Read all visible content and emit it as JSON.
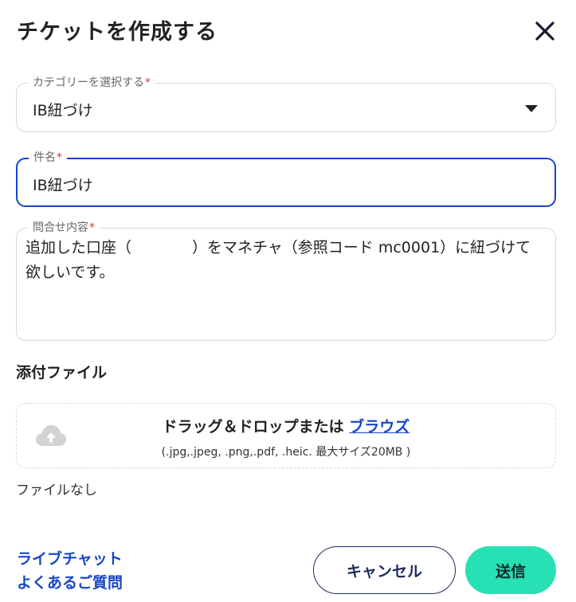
{
  "modal": {
    "title": "チケットを作成する",
    "close_icon": "close-icon"
  },
  "category": {
    "label": "カテゴリーを選択する",
    "required_mark": "*",
    "value": "IB紐づけ",
    "icon": "caret-down-icon"
  },
  "subject": {
    "label": "件名",
    "required_mark": "*",
    "value": "IB紐づけ"
  },
  "inquiry": {
    "label": "問合せ内容",
    "required_mark": "*",
    "value": "追加した口座（　　　　）をマネチャ（参照コード mc0001）に紐づけて欲しいです。"
  },
  "attachment": {
    "section_title": "添付ファイル",
    "drop_text": "ドラッグ＆ドロップまたは ",
    "browse_label": "ブラウズ",
    "hint": "(.jpg,.jpeg, .png,.pdf, .heic. 最大サイズ20MB )",
    "no_file_text": "ファイルなし",
    "icon": "cloud-upload-icon"
  },
  "footer": {
    "live_chat_label": "ライブチャット",
    "faq_label": "よくあるご質問",
    "cancel_label": "キャンセル",
    "submit_label": "送信"
  },
  "colors": {
    "accent_blue": "#1746c9",
    "submit_green": "#27e0b3",
    "cancel_border": "#1d2d5c",
    "required_red": "#dd3333"
  }
}
